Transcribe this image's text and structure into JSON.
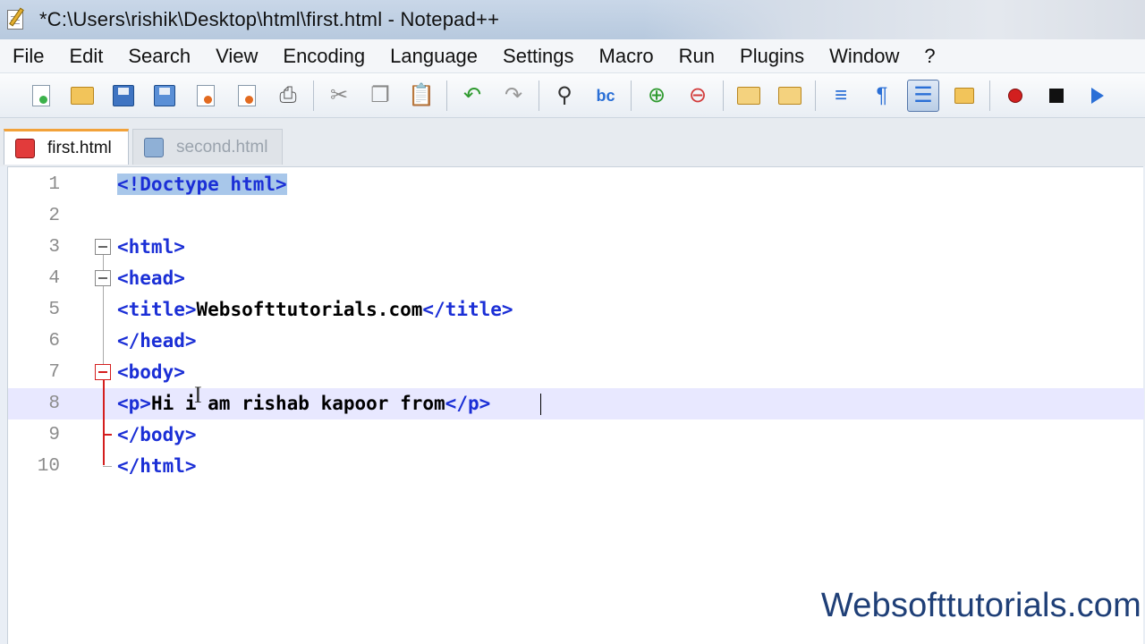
{
  "window": {
    "title": "*C:\\Users\\rishik\\Desktop\\html\\first.html - Notepad++"
  },
  "menu": [
    {
      "label": "File"
    },
    {
      "label": "Edit"
    },
    {
      "label": "Search"
    },
    {
      "label": "View"
    },
    {
      "label": "Encoding"
    },
    {
      "label": "Language"
    },
    {
      "label": "Settings"
    },
    {
      "label": "Macro"
    },
    {
      "label": "Run"
    },
    {
      "label": "Plugins"
    },
    {
      "label": "Window"
    },
    {
      "label": "?"
    }
  ],
  "toolbar": {
    "icons": [
      "new-file-icon",
      "open-folder-icon",
      "save-icon",
      "save-all-icon",
      "close-icon",
      "close-all-icon",
      "print-icon",
      "cut-icon",
      "copy-icon",
      "paste-icon",
      "undo-icon",
      "redo-icon",
      "find-icon",
      "replace-icon",
      "zoom-in-icon",
      "zoom-out-icon",
      "sync-vertical-icon",
      "sync-horizontal-icon",
      "word-wrap-icon",
      "show-all-chars-icon",
      "indent-guide-icon",
      "user-defined-lang-icon",
      "record-macro-icon",
      "stop-recording-icon",
      "play-macro-icon"
    ],
    "active": "indent-guide-icon"
  },
  "tabs": [
    {
      "label": "first.html",
      "active": true,
      "modified": true
    },
    {
      "label": "second.html",
      "active": false
    }
  ],
  "editor": {
    "lines": [
      {
        "num": "1",
        "text": "<!Doctype html>"
      },
      {
        "num": "2",
        "text": ""
      },
      {
        "num": "3",
        "text": "<html>"
      },
      {
        "num": "4",
        "text": "<head>"
      },
      {
        "num": "5",
        "text": "<title>Websofttutorials.com</title>"
      },
      {
        "num": "6",
        "text": "</head>"
      },
      {
        "num": "7",
        "text": "<body>"
      },
      {
        "num": "8",
        "text": "<p>Hi i am rishab kapoor from</p>"
      },
      {
        "num": "9",
        "text": "</body>"
      },
      {
        "num": "10",
        "text": "</html>"
      }
    ],
    "current_line": 8,
    "tokens": {
      "l5_open": "<title>",
      "l5_text": "Websofttutorials.com",
      "l5_close": "</title>",
      "l8_open": "<p>",
      "l8_text": "Hi i am rishab kapoor from",
      "l8_close": "</p>"
    }
  },
  "watermark": "Websofttutorials.com",
  "colors": {
    "tag": "#1b2fd6",
    "current_line": "#e8e8ff",
    "fold_active": "#d41e1e",
    "brace_highlight": "#a8c7ea"
  }
}
